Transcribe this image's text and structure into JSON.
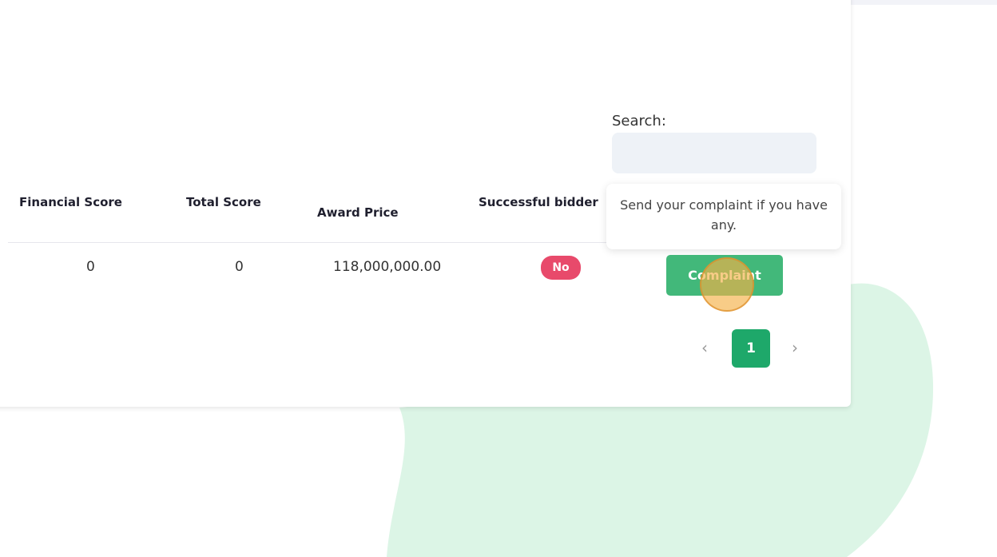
{
  "search": {
    "label": "Search:",
    "value": "",
    "placeholder": ""
  },
  "table": {
    "columns": [
      "Financial Score",
      "Total Score",
      "Award Price",
      "Successful bidder"
    ],
    "rows": [
      {
        "financial_score": "0",
        "total_score": "0",
        "award_price": "118,000,000.00",
        "successful_bidder": "No"
      }
    ]
  },
  "tooltip": {
    "text": "Send your complaint if you have any."
  },
  "actions": {
    "complaint_label": "Complaint"
  },
  "pagination": {
    "prev": "‹",
    "current": "1",
    "next": "›"
  },
  "colors": {
    "page_background": "#f2f3f8",
    "blob": "#dcf5e6",
    "complaint_button": "#42b87a",
    "badge_no": "#e84a6b",
    "page_active": "#1ea86a",
    "click_marker": "#f4b046"
  },
  "icons": {
    "prev": "chevron-left-icon",
    "next": "chevron-right-icon"
  }
}
